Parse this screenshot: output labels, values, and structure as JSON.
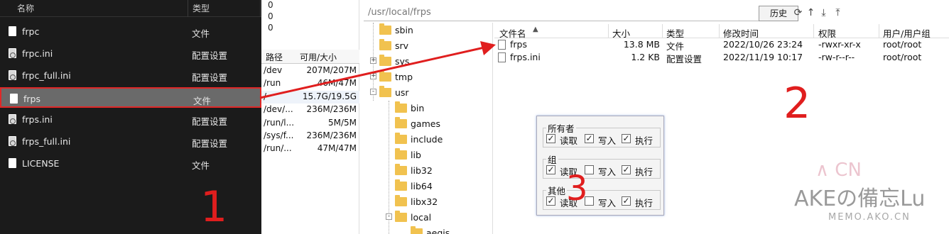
{
  "explorer": {
    "col_name": "名称",
    "col_type": "类型",
    "files": [
      {
        "name": "frpc",
        "type": "文件",
        "icon": "file-icon"
      },
      {
        "name": "frpc.ini",
        "type": "配置设置",
        "icon": "config-file-icon"
      },
      {
        "name": "frpc_full.ini",
        "type": "配置设置",
        "icon": "config-file-icon"
      },
      {
        "name": "frps",
        "type": "文件",
        "icon": "file-icon",
        "selected": true
      },
      {
        "name": "frps.ini",
        "type": "配置设置",
        "icon": "config-file-icon"
      },
      {
        "name": "frps_full.ini",
        "type": "配置设置",
        "icon": "config-file-icon"
      },
      {
        "name": "LICENSE",
        "type": "文件",
        "icon": "file-icon"
      }
    ]
  },
  "disk_panel": {
    "zeros": [
      "0",
      "0",
      "0"
    ],
    "col_path": "路径",
    "col_size": "可用/大小",
    "rows": [
      {
        "path": "/dev",
        "size": "207M/207M"
      },
      {
        "path": "/run",
        "size": "46M/47M"
      },
      {
        "path": "/",
        "size": "15.7G/19.5G"
      },
      {
        "path": "/dev/...",
        "size": "236M/236M"
      },
      {
        "path": "/run/l...",
        "size": "5M/5M"
      },
      {
        "path": "/sys/f...",
        "size": "236M/236M"
      },
      {
        "path": "/run/...",
        "size": "47M/47M"
      }
    ]
  },
  "pathbar": {
    "path": "/usr/local/frps",
    "history_label": "历史",
    "icons": [
      "refresh-icon",
      "up-directory-icon",
      "download-icon",
      "upload-icon"
    ]
  },
  "tree": {
    "items": [
      {
        "label": "sbin",
        "level": 1
      },
      {
        "label": "srv",
        "level": 1
      },
      {
        "label": "sys",
        "level": 1,
        "expander": "+"
      },
      {
        "label": "tmp",
        "level": 1,
        "expander": "+"
      },
      {
        "label": "usr",
        "level": 1,
        "expander": "-"
      },
      {
        "label": "bin",
        "level": 2
      },
      {
        "label": "games",
        "level": 2
      },
      {
        "label": "include",
        "level": 2
      },
      {
        "label": "lib",
        "level": 2
      },
      {
        "label": "lib32",
        "level": 2
      },
      {
        "label": "lib64",
        "level": 2
      },
      {
        "label": "libx32",
        "level": 2
      },
      {
        "label": "local",
        "level": 2,
        "expander": "-"
      },
      {
        "label": "aegis",
        "level": 3
      }
    ]
  },
  "filelist": {
    "columns": {
      "name": "文件名",
      "size": "大小",
      "type": "类型",
      "mtime": "修改时间",
      "perm": "权限",
      "owner": "用户/用户组"
    },
    "rows": [
      {
        "name": "frps",
        "size": "13.8 MB",
        "type": "文件",
        "mtime": "2022/10/26 23:24",
        "perm": "-rwxr-xr-x",
        "owner": "root/root"
      },
      {
        "name": "frps.ini",
        "size": "1.2 KB",
        "type": "配置设置",
        "mtime": "2022/11/19 10:17",
        "perm": "-rw-r--r--",
        "owner": "root/root"
      }
    ]
  },
  "permissions": {
    "read": "读取",
    "write": "写入",
    "exec": "执行",
    "groups": [
      {
        "label": "所有者",
        "read": true,
        "write": true,
        "exec": true
      },
      {
        "label": "组",
        "read": true,
        "write": false,
        "exec": true
      },
      {
        "label": "其他",
        "read": true,
        "write": false,
        "exec": true
      }
    ]
  },
  "annotations": {
    "n1": "1",
    "n2": "2",
    "n3": "3",
    "color": "#e01e1e"
  },
  "watermark": {
    "main": "AKEの備忘Lu",
    "sub": "MEMO.AKO.CN",
    "logo": "∧ CN"
  }
}
